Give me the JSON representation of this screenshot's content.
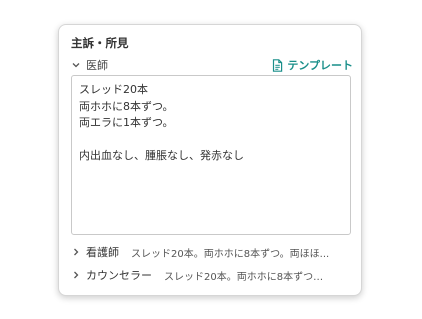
{
  "card": {
    "title": "主訴・所見"
  },
  "doctor": {
    "label": "医師",
    "template_label": "テンプレート",
    "note": "スレッド20本\n両ホホに8本ずつ。\n両エラに1本ずつ。\n\n内出血なし、腫脹なし、発赤なし"
  },
  "nurse": {
    "label": "看護師",
    "preview": "スレッド20本。両ホホに8本ずつ。両ほほ..."
  },
  "counselor": {
    "label": "カウンセラー",
    "preview": "スレッド20本。両ホホに8本ずつ…"
  },
  "colors": {
    "accent": "#1a8f8a",
    "border": "#c9c9c9"
  },
  "icons": {
    "collapse": "chevron-down-icon",
    "expand": "chevron-right-icon",
    "template": "document-icon"
  }
}
